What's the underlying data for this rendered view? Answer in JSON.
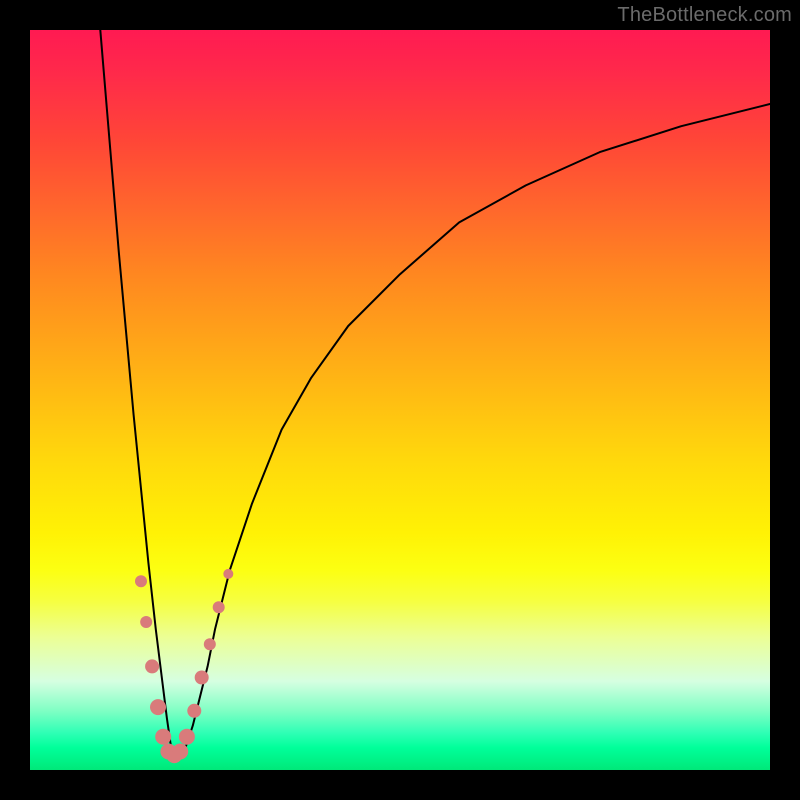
{
  "watermark": "TheBottleneck.com",
  "colors": {
    "frame": "#000000",
    "curve": "#000000",
    "points": "#d97b7b",
    "gradient_top": "#ff1a52",
    "gradient_bottom": "#00e879"
  },
  "chart_data": {
    "type": "line",
    "title": "",
    "xlabel": "",
    "ylabel": "",
    "xlim": [
      0,
      100
    ],
    "ylim": [
      0,
      100
    ],
    "note": "V-shaped bottleneck curve; y represents mismatch magnitude (higher = worse/red) and x represents a component performance index. Curve minimum near x≈19. Values read approximately from pixel positions — axes have no numeric tick labels in the source image.",
    "series": [
      {
        "name": "bottleneck-curve",
        "x": [
          9.5,
          10,
          11,
          12,
          13,
          14,
          15,
          16,
          17,
          18,
          18.5,
          19,
          19.5,
          20,
          21,
          22,
          23,
          24,
          25,
          27,
          30,
          34,
          38,
          43,
          50,
          58,
          67,
          77,
          88,
          100
        ],
        "y": [
          100,
          94,
          82,
          70,
          59,
          48,
          38,
          28,
          19,
          11,
          7,
          3.5,
          2,
          2,
          3,
          6,
          10,
          14,
          19,
          27,
          36,
          46,
          53,
          60,
          67,
          74,
          79,
          83.5,
          87,
          90
        ]
      }
    ],
    "points": [
      {
        "x": 15.0,
        "y": 25.5,
        "r": 6
      },
      {
        "x": 15.7,
        "y": 20.0,
        "r": 6
      },
      {
        "x": 16.5,
        "y": 14.0,
        "r": 7
      },
      {
        "x": 17.3,
        "y": 8.5,
        "r": 8
      },
      {
        "x": 18.0,
        "y": 4.5,
        "r": 8
      },
      {
        "x": 18.7,
        "y": 2.5,
        "r": 8
      },
      {
        "x": 19.5,
        "y": 2.0,
        "r": 8
      },
      {
        "x": 20.3,
        "y": 2.5,
        "r": 8
      },
      {
        "x": 21.2,
        "y": 4.5,
        "r": 8
      },
      {
        "x": 22.2,
        "y": 8.0,
        "r": 7
      },
      {
        "x": 23.2,
        "y": 12.5,
        "r": 7
      },
      {
        "x": 24.3,
        "y": 17.0,
        "r": 6
      },
      {
        "x": 25.5,
        "y": 22.0,
        "r": 6
      },
      {
        "x": 26.8,
        "y": 26.5,
        "r": 5
      }
    ]
  }
}
